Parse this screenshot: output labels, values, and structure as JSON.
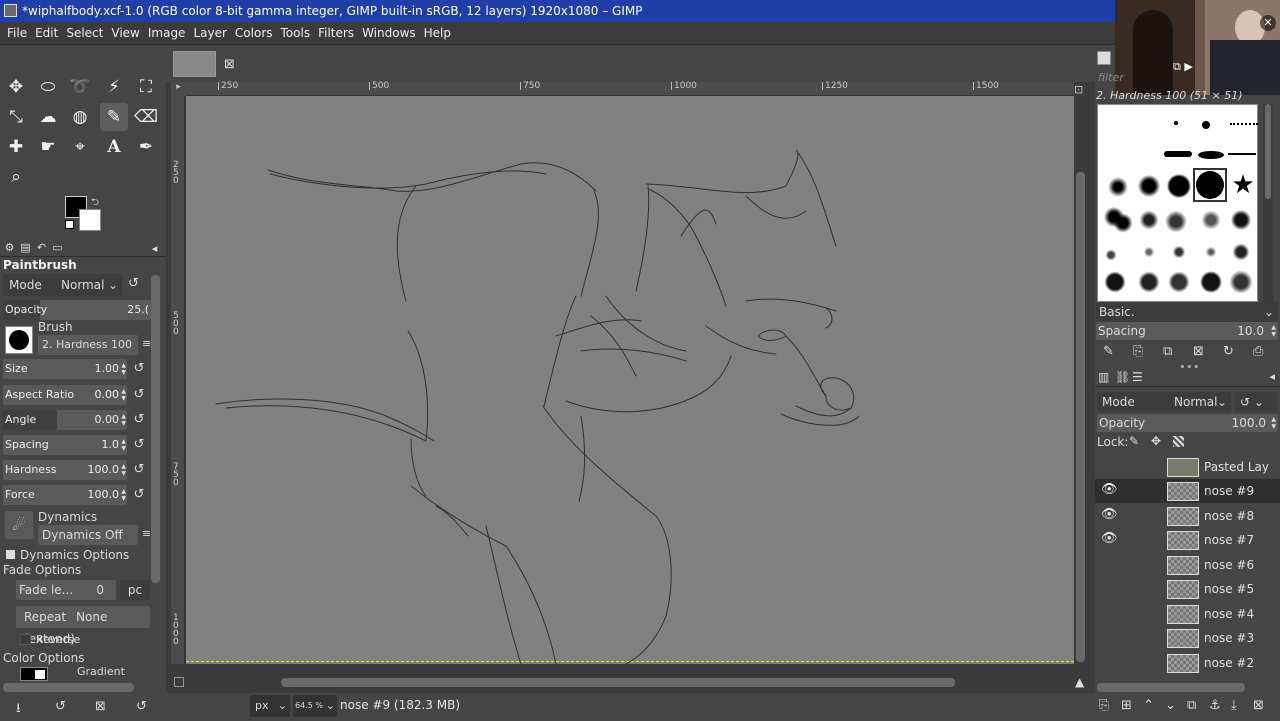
{
  "titlebar": {
    "title": "*wiphalfbody.xcf-1.0 (RGB color 8-bit gamma integer, GIMP built-in sRGB, 12 layers) 1920x1080 – GIMP"
  },
  "menu": [
    "File",
    "Edit",
    "Select",
    "View",
    "Image",
    "Layer",
    "Colors",
    "Tools",
    "Filters",
    "Windows",
    "Help"
  ],
  "toolbox": {
    "tools": [
      "move-tool",
      "ellipse-select-tool",
      "free-select-tool",
      "fuzzy-select-tool",
      "crop-tool",
      "unified-transform-tool",
      "warp-transform-tool",
      "bucket-fill-tool",
      "paintbrush-tool",
      "eraser-tool",
      "heal-tool",
      "smudge-tool",
      "paths-tool",
      "text-tool",
      "color-picker-tool",
      "zoom-tool"
    ],
    "active": "paintbrush-tool",
    "fg_color": "#000000",
    "bg_color": "#ffffff"
  },
  "tool_options": {
    "title": "Paintbrush",
    "mode_label": "Mode",
    "mode_value": "Normal",
    "opacity_label": "Opacity",
    "opacity_value": "25.(",
    "brush_label": "Brush",
    "brush_value": "2. Hardness 100",
    "size_label": "Size",
    "size_value": "1.00",
    "aspect_label": "Aspect Ratio",
    "aspect_value": "0.00",
    "angle_label": "Angle",
    "angle_value": "0.00",
    "spacing_label": "Spacing",
    "spacing_value": "1.0",
    "hardness_label": "Hardness",
    "hardness_value": "100.0",
    "force_label": "Force",
    "force_value": "100.0",
    "dynamics_label": "Dynamics",
    "dynamics_value": "Dynamics Off",
    "dynamics_options": "Dynamics Options",
    "fade_options": "Fade Options",
    "fade_length_label": "Fade le...",
    "fade_length_value": "0",
    "fade_unit": "pc",
    "repeat_label": "Repeat",
    "repeat_value": "None (extend)",
    "reverse_label": "Reverse",
    "color_options": "Color Options",
    "gradient_label": "Gradient"
  },
  "canvas": {
    "tab_close": "⊠",
    "hruler_labels": [
      "250",
      "500",
      "750",
      "1000",
      "1250",
      "1500"
    ],
    "vruler_labels": [
      "250",
      "500",
      "750",
      "1000"
    ],
    "unit": "px",
    "zoom": "64.5 %",
    "status": "nose #9 (182.3 MB)"
  },
  "webcam": {
    "label": "⧉ ▶",
    "close": "✕"
  },
  "brushes": {
    "filter_placeholder": "filter",
    "header": "2. Hardness 100 (51 × 51)",
    "preset": "Basic.",
    "spacing_label": "Spacing",
    "spacing_value": "10.0"
  },
  "layers": {
    "mode_label": "Mode",
    "mode_value": "Normal",
    "opacity_label": "Opacity",
    "opacity_value": "100.0",
    "lock_label": "Lock:",
    "items": [
      {
        "name": "Pasted Lay",
        "visible": false,
        "selected": false
      },
      {
        "name": "nose #9",
        "visible": true,
        "selected": true
      },
      {
        "name": "nose #8",
        "visible": true,
        "selected": false
      },
      {
        "name": "nose #7",
        "visible": true,
        "selected": false
      },
      {
        "name": "nose #6",
        "visible": false,
        "selected": false
      },
      {
        "name": "nose #5",
        "visible": false,
        "selected": false
      },
      {
        "name": "nose #4",
        "visible": false,
        "selected": false
      },
      {
        "name": "nose #3",
        "visible": false,
        "selected": false
      },
      {
        "name": "nose #2",
        "visible": false,
        "selected": false
      }
    ]
  }
}
